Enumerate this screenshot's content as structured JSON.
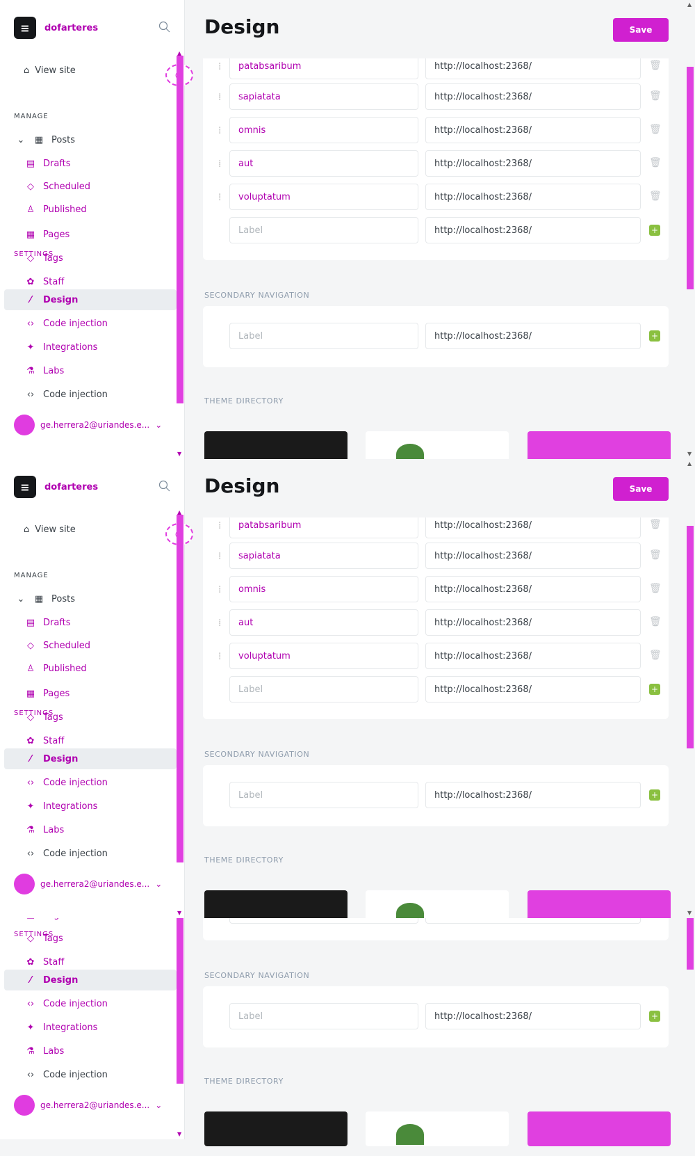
{
  "brand": {
    "name": "dofarteres",
    "logo_glyph": "≡"
  },
  "sidebar": {
    "view_site": "View site",
    "manage_label": "MANAGE",
    "settings_label": "SETTINGS",
    "items": [
      {
        "label": "Posts"
      },
      {
        "label": "Drafts"
      },
      {
        "label": "Scheduled"
      },
      {
        "label": "Published"
      },
      {
        "label": "Pages"
      },
      {
        "label": "Tags"
      },
      {
        "label": "Staff"
      },
      {
        "label": "Design"
      },
      {
        "label": "Code injection"
      },
      {
        "label": "Integrations"
      },
      {
        "label": "Labs"
      }
    ],
    "user_email": "ge.herrera2@uriandes.e..."
  },
  "header": {
    "title": "Design",
    "save_label": "Save"
  },
  "primary_navigation": {
    "rows": [
      {
        "label": "patabsaribum",
        "url": "http://localhost:2368/"
      },
      {
        "label": "sapiatata",
        "url": "http://localhost:2368/"
      },
      {
        "label": "omnis",
        "url": "http://localhost:2368/"
      },
      {
        "label": "aut",
        "url": "http://localhost:2368/"
      },
      {
        "label": "voluptatum",
        "url": "http://localhost:2368/"
      }
    ],
    "new_label_placeholder": "Label",
    "new_url": "http://localhost:2368/"
  },
  "secondary_navigation": {
    "title": "SECONDARY NAVIGATION",
    "label_placeholder": "Label",
    "url": "http://localhost:2368/"
  },
  "theme_directory": {
    "title": "THEME DIRECTORY"
  },
  "colors": {
    "accent": "#d020d0",
    "add_button": "#8ac040"
  }
}
